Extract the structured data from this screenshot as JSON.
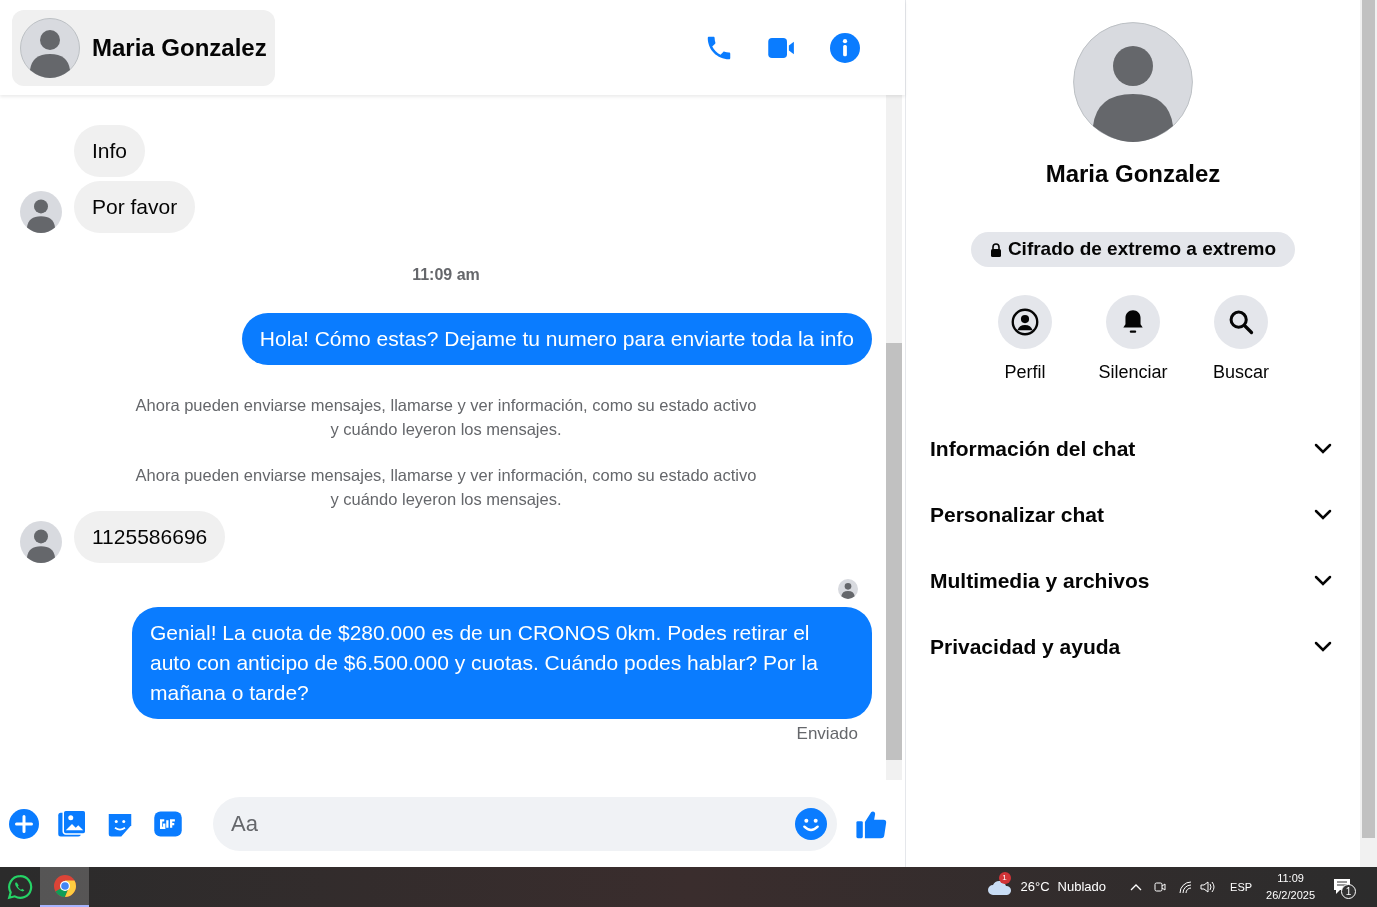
{
  "header": {
    "name": "Maria Gonzalez"
  },
  "messages": [
    {
      "kind": "incoming",
      "text": "Info",
      "avatar": false
    },
    {
      "kind": "incoming",
      "text": "Por favor",
      "avatar": true
    },
    {
      "kind": "time",
      "text": "11:09 am"
    },
    {
      "kind": "outgoing",
      "text": "Hola! Cómo estas? Dejame tu numero para enviarte toda la info"
    },
    {
      "kind": "system",
      "text": "Ahora pueden enviarse mensajes, llamarse y ver información, como su estado activo y cuándo leyeron los mensajes."
    },
    {
      "kind": "system",
      "text": "Ahora pueden enviarse mensajes, llamarse y ver información, como su estado activo y cuándo leyeron los mensajes."
    },
    {
      "kind": "incoming",
      "text": "1125586696",
      "avatar": true
    },
    {
      "kind": "seen"
    },
    {
      "kind": "outgoing",
      "text": "Genial! La cuota de $280.000 es de un CRONOS 0km. Podes retirar el auto con anticipo de $6.500.000 y cuotas. Cuándo podes hablar? Por la mañana o tarde?"
    },
    {
      "kind": "status",
      "text": "Enviado"
    }
  ],
  "composer": {
    "placeholder": "Aa"
  },
  "profile": {
    "name": "Maria Gonzalez",
    "badge": "Cifrado de extremo a extremo",
    "actions": [
      {
        "kind": "profile",
        "label": "Perfil"
      },
      {
        "kind": "mute",
        "label": "Silenciar"
      },
      {
        "kind": "search",
        "label": "Buscar"
      }
    ],
    "sections": [
      {
        "label": "Información del chat",
        "expanded": false
      },
      {
        "label": "Personalizar chat",
        "expanded": false
      },
      {
        "label": "Multimedia y archivos",
        "expanded": false
      },
      {
        "label": "Privacidad y ayuda",
        "expanded": false
      }
    ]
  },
  "taskbar": {
    "weather_badge": "1",
    "temperature": "26°C",
    "weather": "Nublado",
    "language": "ESP",
    "time": "11:09",
    "date": "26/2/2025",
    "notification_count": "1"
  }
}
